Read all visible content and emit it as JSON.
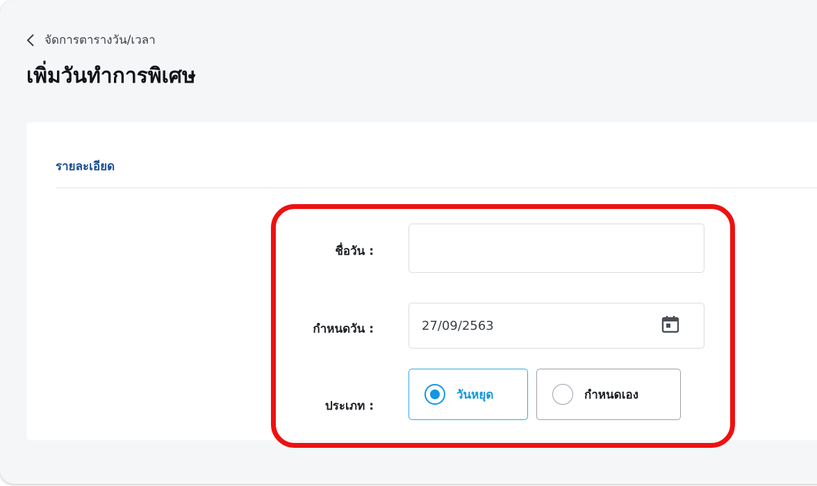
{
  "breadcrumb": {
    "back_icon": "chevron-left-icon",
    "label": "จัดการตารางวัน/เวลา"
  },
  "page_title": "เพิ่มวันทำการพิเศษ",
  "section": {
    "title": "รายละเอียด"
  },
  "form": {
    "day_name": {
      "label": "ชื่อวัน :",
      "value": "",
      "placeholder": ""
    },
    "date": {
      "label": "กำหนดวัน :",
      "value": "27/09/2563",
      "icon": "calendar-icon"
    },
    "type": {
      "label": "ประเภท :",
      "options": [
        {
          "label": "วันหยุด",
          "selected": true
        },
        {
          "label": "กำหนดเอง",
          "selected": false
        }
      ]
    }
  },
  "colors": {
    "accent": "#1296e0",
    "section_title": "#1a4f93",
    "highlight": "#ee1111"
  }
}
